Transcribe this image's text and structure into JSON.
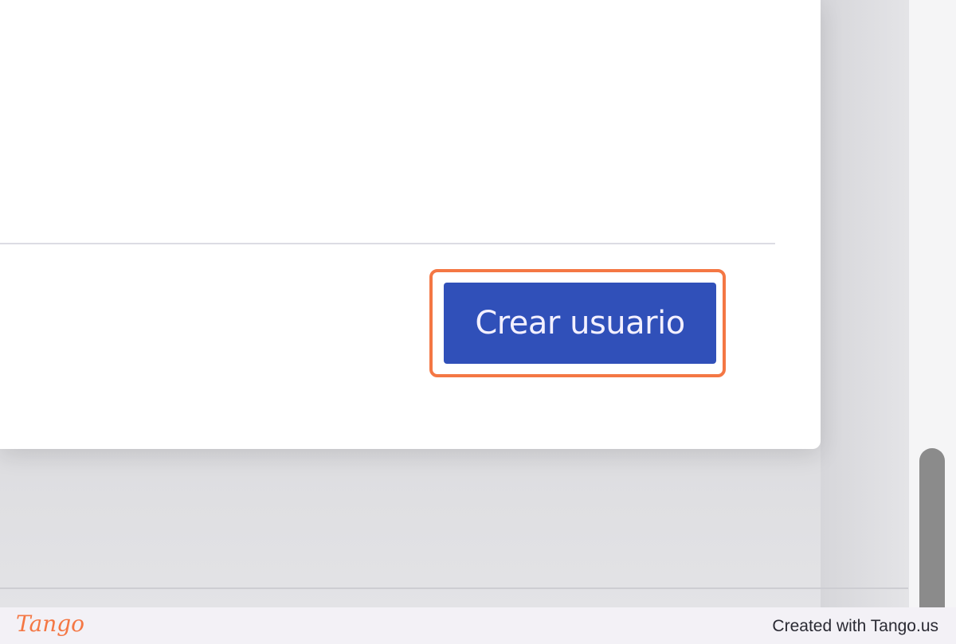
{
  "dialog": {
    "primary_button_label": "Crear usuario"
  },
  "footer": {
    "brand": "Tango",
    "credit": "Created with Tango.us"
  },
  "colors": {
    "primary_button": "#3050b9",
    "highlight_outline": "#f47744",
    "brand": "#f47744"
  }
}
